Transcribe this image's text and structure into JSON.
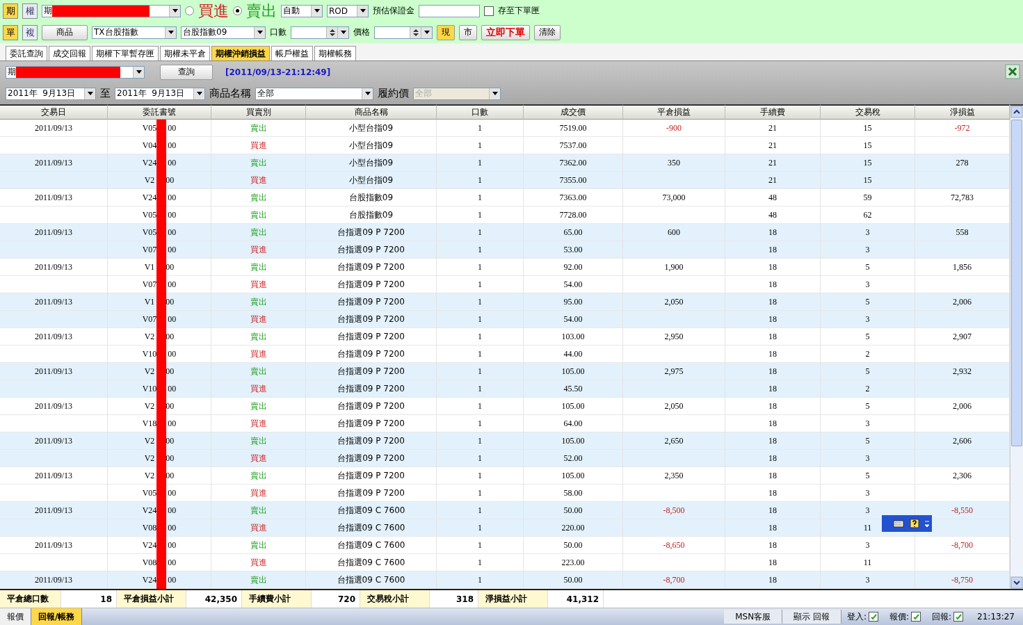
{
  "order_bar": {
    "mode_buttons": [
      {
        "label": "期",
        "selected": true
      },
      {
        "label": "權",
        "selected": false
      }
    ],
    "account": {
      "value": "期"
    },
    "sides": [
      {
        "label": "買進",
        "kind": "buy",
        "selected": false
      },
      {
        "label": "賣出",
        "kind": "sell",
        "selected": true
      }
    ],
    "condition": "自動",
    "time_in_force": "ROD",
    "margin_label": "預估保證金",
    "save_checkbox": {
      "label": "存至下單匣",
      "checked": false
    },
    "type_buttons": [
      {
        "label": "單",
        "selected": true
      },
      {
        "label": "複",
        "selected": false
      }
    ],
    "product_button": "商品",
    "product": "TX台股指數",
    "contract": "台股指數09",
    "qty_label": "口數",
    "price_label": "價格",
    "price_buttons": [
      {
        "label": "現",
        "selected": true
      },
      {
        "label": "市",
        "selected": false
      }
    ],
    "submit": "立即下單",
    "clear": "清除"
  },
  "tabs": [
    {
      "label": "委託查詢",
      "selected": false
    },
    {
      "label": "成交回報",
      "selected": false
    },
    {
      "label": "期權下單暫存匣",
      "selected": false
    },
    {
      "label": "期權未平倉",
      "selected": false
    },
    {
      "label": "期權沖銷損益",
      "selected": true
    },
    {
      "label": "帳戶權益",
      "selected": false
    },
    {
      "label": "期權帳務",
      "selected": false
    }
  ],
  "query": {
    "account": "期",
    "button": "查詢",
    "timestamp": "[2011/09/13-21:12:49]",
    "date_from": "2011年  9月13日",
    "to_label": "至",
    "date_to": "2011年  9月13日",
    "product_label": "商品名稱",
    "product": "全部",
    "strike_label": "履約價",
    "strike": "全部"
  },
  "table": {
    "columns": [
      "交易日",
      "委託書號",
      "買賣別",
      "商品名稱",
      "口數",
      "成交價",
      "平倉損益",
      "手續費",
      "交易稅",
      "淨損益"
    ],
    "rows": [
      {
        "date": "2011/09/13",
        "order_start": "V05",
        "order_end": "00",
        "side": {
          "text": "賣出",
          "kind": "sell"
        },
        "product": "小型台指09",
        "qty": "1",
        "price": "7519.00",
        "pnl": {
          "text": "-900",
          "kind": "loss"
        },
        "fee": "21",
        "tax": "15",
        "net": {
          "text": "-972",
          "kind": "loss"
        },
        "shaded": false
      },
      {
        "order_start": "V04",
        "order_end": "00",
        "side": {
          "text": "買進",
          "kind": "buy"
        },
        "product": "小型台指09",
        "qty": "1",
        "price": "7537.00",
        "fee": "21",
        "tax": "15",
        "shaded": false
      },
      {
        "date": "2011/09/13",
        "order_start": "V24",
        "order_end": "00",
        "side": {
          "text": "賣出",
          "kind": "sell"
        },
        "product": "小型台指09",
        "qty": "1",
        "price": "7362.00",
        "pnl": {
          "text": "350",
          "kind": "gain"
        },
        "fee": "21",
        "tax": "15",
        "net": {
          "text": "278",
          "kind": "gain"
        },
        "shaded": true
      },
      {
        "order_start": "V2",
        "order_end": "00",
        "side": {
          "text": "買進",
          "kind": "buy"
        },
        "product": "小型台指09",
        "qty": "1",
        "price": "7355.00",
        "fee": "21",
        "tax": "15",
        "shaded": true
      },
      {
        "date": "2011/09/13",
        "order_start": "V24",
        "order_end": "00",
        "side": {
          "text": "賣出",
          "kind": "sell"
        },
        "product": "台股指數09",
        "qty": "1",
        "price": "7363.00",
        "pnl": {
          "text": "73,000",
          "kind": "gain"
        },
        "fee": "48",
        "tax": "59",
        "net": {
          "text": "72,783",
          "kind": "gain"
        },
        "shaded": false
      },
      {
        "order_start": "V05",
        "order_end": "00",
        "side": {
          "text": "賣出",
          "kind": "sell"
        },
        "product": "台股指數09",
        "qty": "1",
        "price": "7728.00",
        "fee": "48",
        "tax": "62",
        "shaded": false
      },
      {
        "date": "2011/09/13",
        "order_start": "V05",
        "order_end": "00",
        "side": {
          "text": "賣出",
          "kind": "sell"
        },
        "product": "台指選09 P 7200",
        "qty": "1",
        "price": "65.00",
        "pnl": {
          "text": "600",
          "kind": "gain"
        },
        "fee": "18",
        "tax": "3",
        "net": {
          "text": "558",
          "kind": "gain"
        },
        "shaded": true
      },
      {
        "order_start": "V07",
        "order_end": "00",
        "side": {
          "text": "買進",
          "kind": "buy"
        },
        "product": "台指選09 P 7200",
        "qty": "1",
        "price": "53.00",
        "fee": "18",
        "tax": "3",
        "shaded": true
      },
      {
        "date": "2011/09/13",
        "order_start": "V1",
        "order_end": "00",
        "side": {
          "text": "賣出",
          "kind": "sell"
        },
        "product": "台指選09 P 7200",
        "qty": "1",
        "price": "92.00",
        "pnl": {
          "text": "1,900",
          "kind": "gain"
        },
        "fee": "18",
        "tax": "5",
        "net": {
          "text": "1,856",
          "kind": "gain"
        },
        "shaded": false
      },
      {
        "order_start": "V07",
        "order_end": "00",
        "side": {
          "text": "買進",
          "kind": "buy"
        },
        "product": "台指選09 P 7200",
        "qty": "1",
        "price": "54.00",
        "fee": "18",
        "tax": "3",
        "shaded": false
      },
      {
        "date": "2011/09/13",
        "order_start": "V1",
        "order_end": "00",
        "side": {
          "text": "賣出",
          "kind": "sell"
        },
        "product": "台指選09 P 7200",
        "qty": "1",
        "price": "95.00",
        "pnl": {
          "text": "2,050",
          "kind": "gain"
        },
        "fee": "18",
        "tax": "5",
        "net": {
          "text": "2,006",
          "kind": "gain"
        },
        "shaded": true
      },
      {
        "order_start": "V07",
        "order_end": "00",
        "side": {
          "text": "買進",
          "kind": "buy"
        },
        "product": "台指選09 P 7200",
        "qty": "1",
        "price": "54.00",
        "fee": "18",
        "tax": "3",
        "shaded": true
      },
      {
        "date": "2011/09/13",
        "order_start": "V2",
        "order_end": "00",
        "side": {
          "text": "賣出",
          "kind": "sell"
        },
        "product": "台指選09 P 7200",
        "qty": "1",
        "price": "103.00",
        "pnl": {
          "text": "2,950",
          "kind": "gain"
        },
        "fee": "18",
        "tax": "5",
        "net": {
          "text": "2,907",
          "kind": "gain"
        },
        "shaded": false
      },
      {
        "order_start": "V10",
        "order_end": "00",
        "side": {
          "text": "買進",
          "kind": "buy"
        },
        "product": "台指選09 P 7200",
        "qty": "1",
        "price": "44.00",
        "fee": "18",
        "tax": "2",
        "shaded": false
      },
      {
        "date": "2011/09/13",
        "order_start": "V2",
        "order_end": "00",
        "side": {
          "text": "賣出",
          "kind": "sell"
        },
        "product": "台指選09 P 7200",
        "qty": "1",
        "price": "105.00",
        "pnl": {
          "text": "2,975",
          "kind": "gain"
        },
        "fee": "18",
        "tax": "5",
        "net": {
          "text": "2,932",
          "kind": "gain"
        },
        "shaded": true
      },
      {
        "order_start": "V10",
        "order_end": "00",
        "side": {
          "text": "買進",
          "kind": "buy"
        },
        "product": "台指選09 P 7200",
        "qty": "1",
        "price": "45.50",
        "fee": "18",
        "tax": "2",
        "shaded": true
      },
      {
        "date": "2011/09/13",
        "order_start": "V2",
        "order_end": "00",
        "side": {
          "text": "賣出",
          "kind": "sell"
        },
        "product": "台指選09 P 7200",
        "qty": "1",
        "price": "105.00",
        "pnl": {
          "text": "2,050",
          "kind": "gain"
        },
        "fee": "18",
        "tax": "5",
        "net": {
          "text": "2,006",
          "kind": "gain"
        },
        "shaded": false
      },
      {
        "order_start": "V18",
        "order_end": "00",
        "side": {
          "text": "買進",
          "kind": "buy"
        },
        "product": "台指選09 P 7200",
        "qty": "1",
        "price": "64.00",
        "fee": "18",
        "tax": "3",
        "shaded": false
      },
      {
        "date": "2011/09/13",
        "order_start": "V2",
        "order_end": "00",
        "side": {
          "text": "賣出",
          "kind": "sell"
        },
        "product": "台指選09 P 7200",
        "qty": "1",
        "price": "105.00",
        "pnl": {
          "text": "2,650",
          "kind": "gain"
        },
        "fee": "18",
        "tax": "5",
        "net": {
          "text": "2,606",
          "kind": "gain"
        },
        "shaded": true
      },
      {
        "order_start": "V2",
        "order_end": "00",
        "side": {
          "text": "買進",
          "kind": "buy"
        },
        "product": "台指選09 P 7200",
        "qty": "1",
        "price": "52.00",
        "fee": "18",
        "tax": "3",
        "shaded": true
      },
      {
        "date": "2011/09/13",
        "order_start": "V2",
        "order_end": "00",
        "side": {
          "text": "賣出",
          "kind": "sell"
        },
        "product": "台指選09 P 7200",
        "qty": "1",
        "price": "105.00",
        "pnl": {
          "text": "2,350",
          "kind": "gain"
        },
        "fee": "18",
        "tax": "5",
        "net": {
          "text": "2,306",
          "kind": "gain"
        },
        "shaded": false
      },
      {
        "order_start": "V05",
        "order_end": "00",
        "side": {
          "text": "買進",
          "kind": "buy"
        },
        "product": "台指選09 P 7200",
        "qty": "1",
        "price": "58.00",
        "fee": "18",
        "tax": "3",
        "shaded": false
      },
      {
        "date": "2011/09/13",
        "order_start": "V24",
        "order_end": "00",
        "side": {
          "text": "賣出",
          "kind": "sell"
        },
        "product": "台指選09 C 7600",
        "qty": "1",
        "price": "50.00",
        "pnl": {
          "text": "-8,500",
          "kind": "loss"
        },
        "fee": "18",
        "tax": "3",
        "net": {
          "text": "-8,550",
          "kind": "loss"
        },
        "shaded": true
      },
      {
        "order_start": "V08",
        "order_end": "00",
        "side": {
          "text": "買進",
          "kind": "buy"
        },
        "product": "台指選09 C 7600",
        "qty": "1",
        "price": "220.00",
        "fee": "18",
        "tax": "11",
        "shaded": true
      },
      {
        "date": "2011/09/13",
        "order_start": "V24",
        "order_end": "00",
        "side": {
          "text": "賣出",
          "kind": "sell"
        },
        "product": "台指選09 C 7600",
        "qty": "1",
        "price": "50.00",
        "pnl": {
          "text": "-8,650",
          "kind": "loss"
        },
        "fee": "18",
        "tax": "3",
        "net": {
          "text": "-8,700",
          "kind": "loss"
        },
        "shaded": false
      },
      {
        "order_start": "V08",
        "order_end": "00",
        "side": {
          "text": "買進",
          "kind": "buy"
        },
        "product": "台指選09 C 7600",
        "qty": "1",
        "price": "223.00",
        "fee": "18",
        "tax": "11",
        "shaded": false
      },
      {
        "date": "2011/09/13",
        "order_start": "V24",
        "order_end": "00",
        "side": {
          "text": "賣出",
          "kind": "sell"
        },
        "product": "台指選09 C 7600",
        "qty": "1",
        "price": "50.00",
        "pnl": {
          "text": "-8,700",
          "kind": "loss"
        },
        "fee": "18",
        "tax": "3",
        "net": {
          "text": "-8,750",
          "kind": "loss"
        },
        "shaded": true
      }
    ]
  },
  "summary": [
    {
      "label": "平倉總口數",
      "value": "18"
    },
    {
      "label": "平倉損益小計",
      "value": "42,350"
    },
    {
      "label": "手續費小計",
      "value": "720"
    },
    {
      "label": "交易稅小計",
      "value": "318"
    },
    {
      "label": "淨損益小計",
      "value": "41,312"
    }
  ],
  "bottom_tabs": [
    {
      "label": "報價",
      "selected": false
    },
    {
      "label": "回報/帳務",
      "selected": true
    }
  ],
  "status_bar": {
    "buttons": [
      "MSN客服",
      "顯示 回報"
    ],
    "indicators": [
      {
        "label": "登入:",
        "checked": true
      },
      {
        "label": "報價:",
        "checked": true
      },
      {
        "label": "回報:",
        "checked": true
      }
    ],
    "time": "21:13:27"
  }
}
